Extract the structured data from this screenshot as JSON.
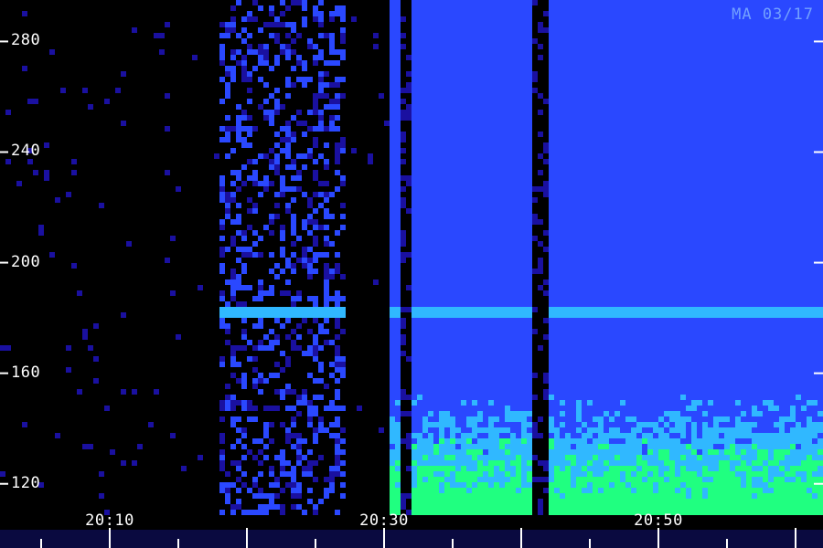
{
  "chart_data": {
    "type": "heatmap",
    "stamp": "MA 03/17",
    "y_ticks": [
      "280",
      "240",
      "200",
      "160",
      "120"
    ],
    "y_tick_values": [
      280,
      240,
      200,
      160,
      120
    ],
    "ylim": [
      110,
      295
    ],
    "x_ticks": [
      "20:10",
      "20:30",
      "20:50"
    ],
    "x_tick_minutes": [
      10,
      30,
      50
    ],
    "xlim_minutes": [
      2,
      62
    ],
    "colors": {
      "background": "#000000",
      "low": "#1a10a0",
      "mid": "#2a48ff",
      "high": "#30b8ff",
      "peak": "#20ff80",
      "axis": "#ffffff"
    },
    "features": {
      "quiet_until_minute": 30.2,
      "strong_band_freq_mhz": 183,
      "dropout_minutes": [
        [
          31.2,
          31.6
        ],
        [
          40.6,
          41.6
        ]
      ],
      "intermittent_minutes": [
        [
          18.0,
          27.0
        ]
      ]
    }
  }
}
